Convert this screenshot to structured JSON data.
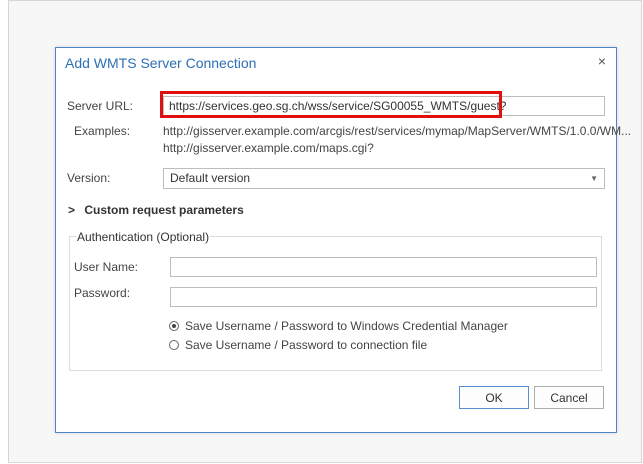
{
  "dialog": {
    "title": "Add WMTS Server Connection",
    "close_glyph": "×",
    "server_url": {
      "label": "Server URL:",
      "value": "https://services.geo.sg.ch/wss/service/SG00055_WMTS/guest?"
    },
    "examples": {
      "label": "Examples:",
      "items": [
        "http://gisserver.example.com/arcgis/rest/services/mymap/MapServer/WMTS/1.0.0/WM...",
        "http://gisserver.example.com/maps.cgi?"
      ]
    },
    "version": {
      "label": "Version:",
      "selected": "Default version"
    },
    "custom_params": {
      "label": "Custom request parameters",
      "chevron": ">"
    },
    "auth": {
      "title": "Authentication (Optional)",
      "username_label": "User Name:",
      "username_value": "",
      "password_label": "Password:",
      "password_value": "",
      "options": [
        {
          "label": "Save Username / Password to Windows Credential Manager",
          "checked": true
        },
        {
          "label": "Save Username / Password to connection file",
          "checked": false
        }
      ]
    },
    "buttons": {
      "ok": "OK",
      "cancel": "Cancel"
    }
  },
  "colors": {
    "title": "#2c6fb5",
    "dialog_border": "#4c86c6",
    "highlight": "#e01010"
  }
}
